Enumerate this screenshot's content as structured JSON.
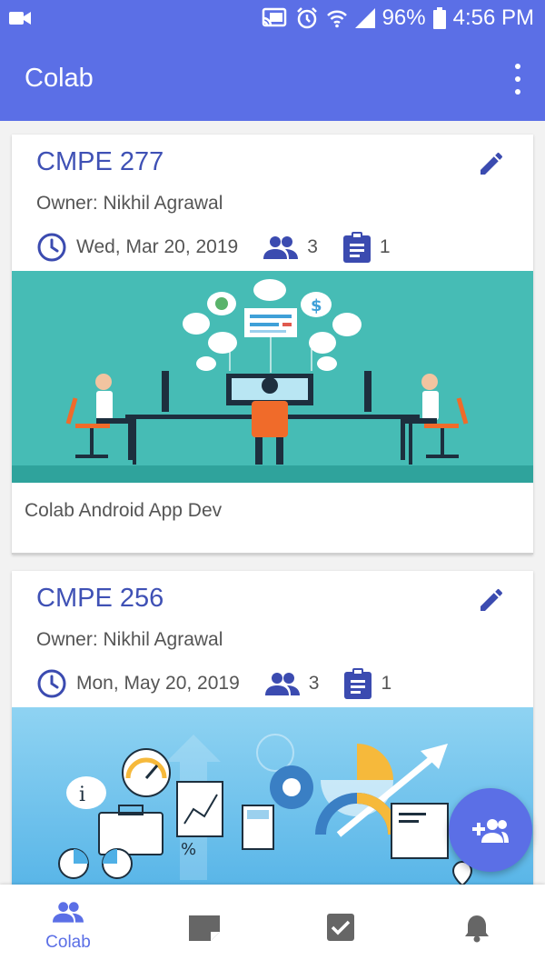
{
  "status_bar": {
    "battery": "96%",
    "time": "4:56 PM"
  },
  "app_bar": {
    "title": "Colab"
  },
  "cards": [
    {
      "title": "CMPE 277",
      "owner": "Owner: Nikhil Agrawal",
      "date": "Wed, Mar 20, 2019",
      "members": "3",
      "tasks": "1",
      "description": "Colab Android App Dev"
    },
    {
      "title": "CMPE 256",
      "owner": "Owner: Nikhil Agrawal",
      "date": "Mon, May 20, 2019",
      "members": "3",
      "tasks": "1"
    }
  ],
  "bottom_nav": {
    "active_label": "Colab",
    "items": [
      {
        "icon": "people-icon"
      },
      {
        "icon": "note-icon"
      },
      {
        "icon": "check-box-icon"
      },
      {
        "icon": "bell-icon"
      }
    ]
  },
  "colors": {
    "primary": "#5b6fe6",
    "title_text": "#3f51b5",
    "icon_indigo": "#3b4bb0",
    "inactive_icon": "#666666"
  }
}
